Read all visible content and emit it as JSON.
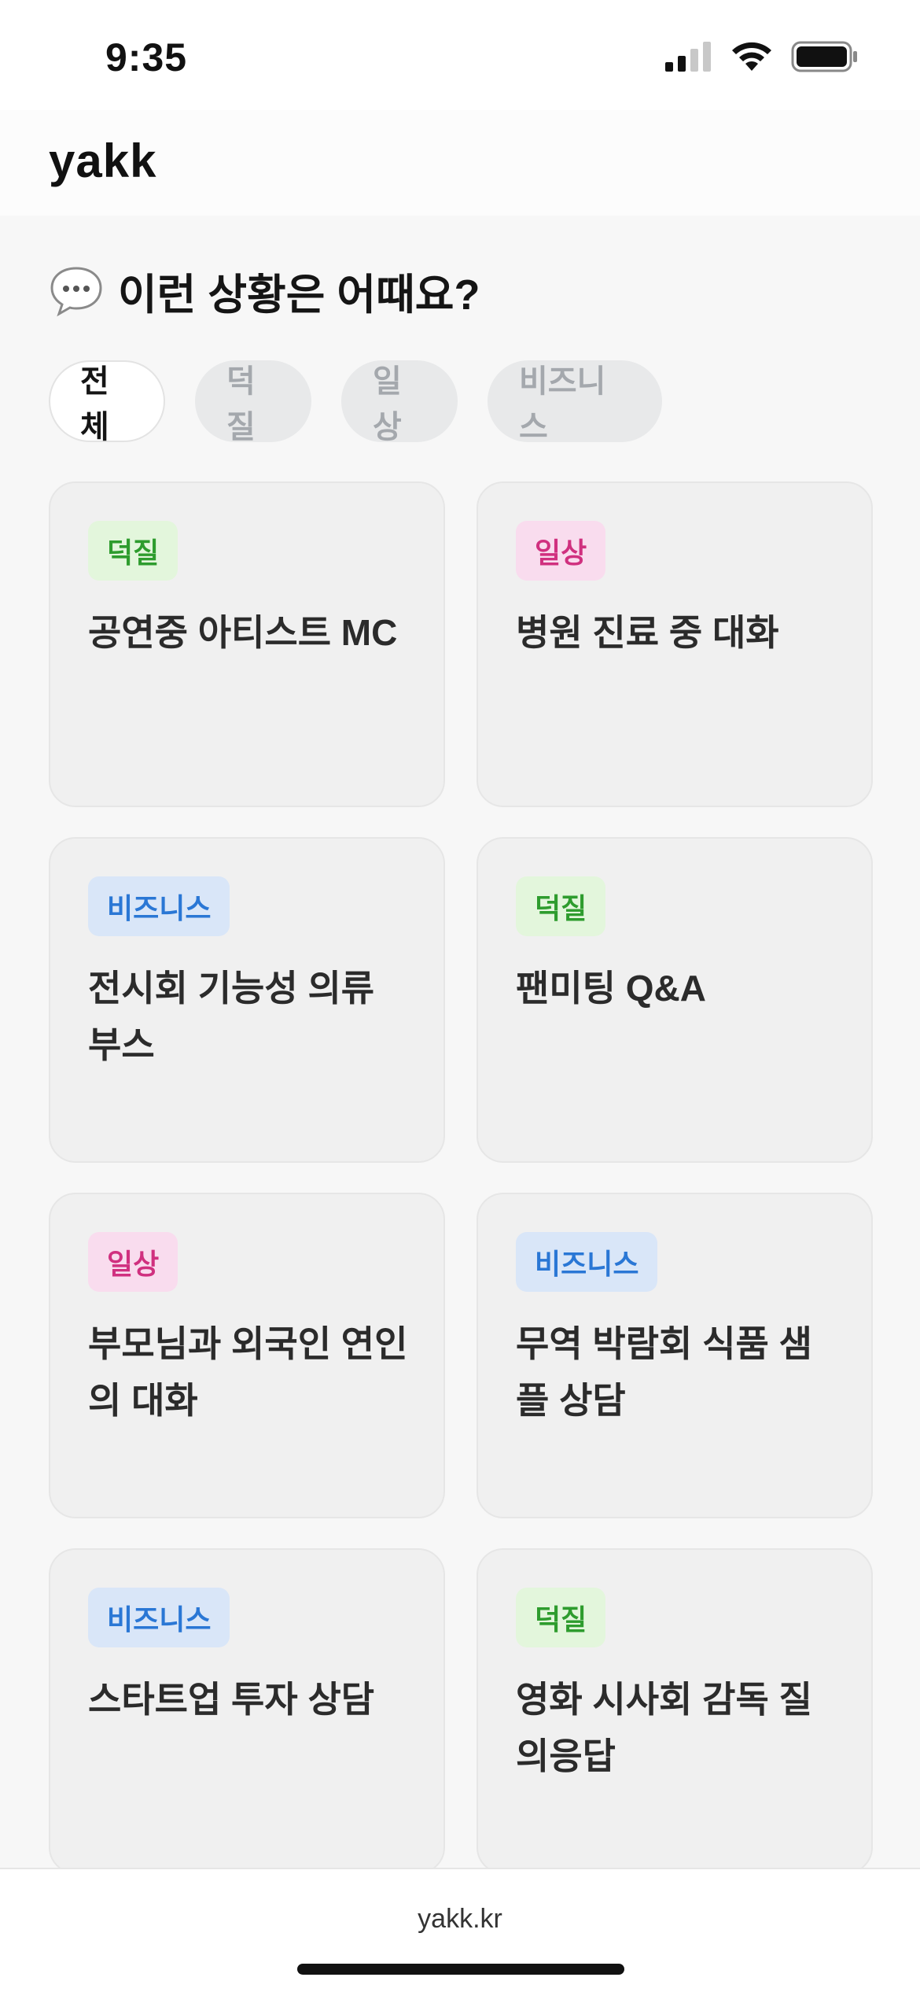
{
  "status_bar": {
    "time": "9:35",
    "icons": [
      "cellular-signal-icon",
      "wifi-icon",
      "battery-icon"
    ]
  },
  "header": {
    "logo": "yakk"
  },
  "section": {
    "icon": "speech-bubble-icon",
    "title": "이런 상황은 어때요?"
  },
  "filters": [
    {
      "label": "전체",
      "active": true
    },
    {
      "label": "덕질",
      "active": false
    },
    {
      "label": "일상",
      "active": false
    },
    {
      "label": "비즈니스",
      "active": false
    }
  ],
  "cards": [
    {
      "tag": "덕질",
      "tag_type": "fandom",
      "title": "공연중 아티스트 MC"
    },
    {
      "tag": "일상",
      "tag_type": "daily",
      "title": "병원 진료 중 대화"
    },
    {
      "tag": "비즈니스",
      "tag_type": "business",
      "title": "전시회 기능성 의류 부스"
    },
    {
      "tag": "덕질",
      "tag_type": "fandom",
      "title": "팬미팅 Q&A"
    },
    {
      "tag": "일상",
      "tag_type": "daily",
      "title": "부모님과 외국인 연인의 대화"
    },
    {
      "tag": "비즈니스",
      "tag_type": "business",
      "title": "무역 박람회 식품 샘플 상담"
    },
    {
      "tag": "비즈니스",
      "tag_type": "business",
      "title": "스타트업 투자 상담"
    },
    {
      "tag": "덕질",
      "tag_type": "fandom",
      "title": "영화 시사회 감독 질의응답"
    }
  ],
  "footer": {
    "url": "yakk.kr"
  },
  "colors": {
    "fandom_bg": "#e3f6dc",
    "fandom_text": "#2e9c2e",
    "daily_bg": "#f9dcee",
    "daily_text": "#d0307f",
    "business_bg": "#d9e6f8",
    "business_text": "#2a77d5"
  }
}
